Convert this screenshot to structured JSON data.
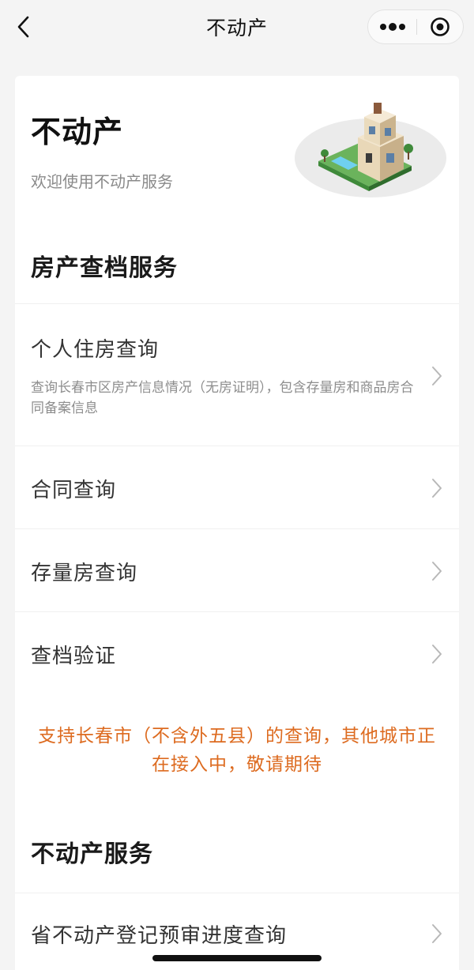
{
  "nav": {
    "title": "不动产",
    "back_icon": "chevron-left-icon",
    "more_icon": "more-dots-icon",
    "close_icon": "target-close-icon"
  },
  "hero": {
    "title": "不动产",
    "subtitle": "欢迎使用不动产服务",
    "illustration": "house-illustration"
  },
  "sections": [
    {
      "title": "房产查档服务",
      "items": [
        {
          "title": "个人住房查询",
          "description": "查询长春市区房产信息情况（无房证明），包含存量房和商品房合同备案信息"
        },
        {
          "title": "合同查询"
        },
        {
          "title": "存量房查询"
        },
        {
          "title": "查档验证"
        }
      ],
      "notice": "支持长春市（不含外五县）的查询，其他城市正在接入中，敬请期待"
    },
    {
      "title": "不动产服务",
      "items": [
        {
          "title": "省不动产登记预审进度查询"
        }
      ]
    }
  ],
  "colors": {
    "background": "#f4f4f4",
    "card": "#ffffff",
    "notice": "#dd6b20",
    "title": "#111111",
    "muted": "#8a8a8a"
  }
}
